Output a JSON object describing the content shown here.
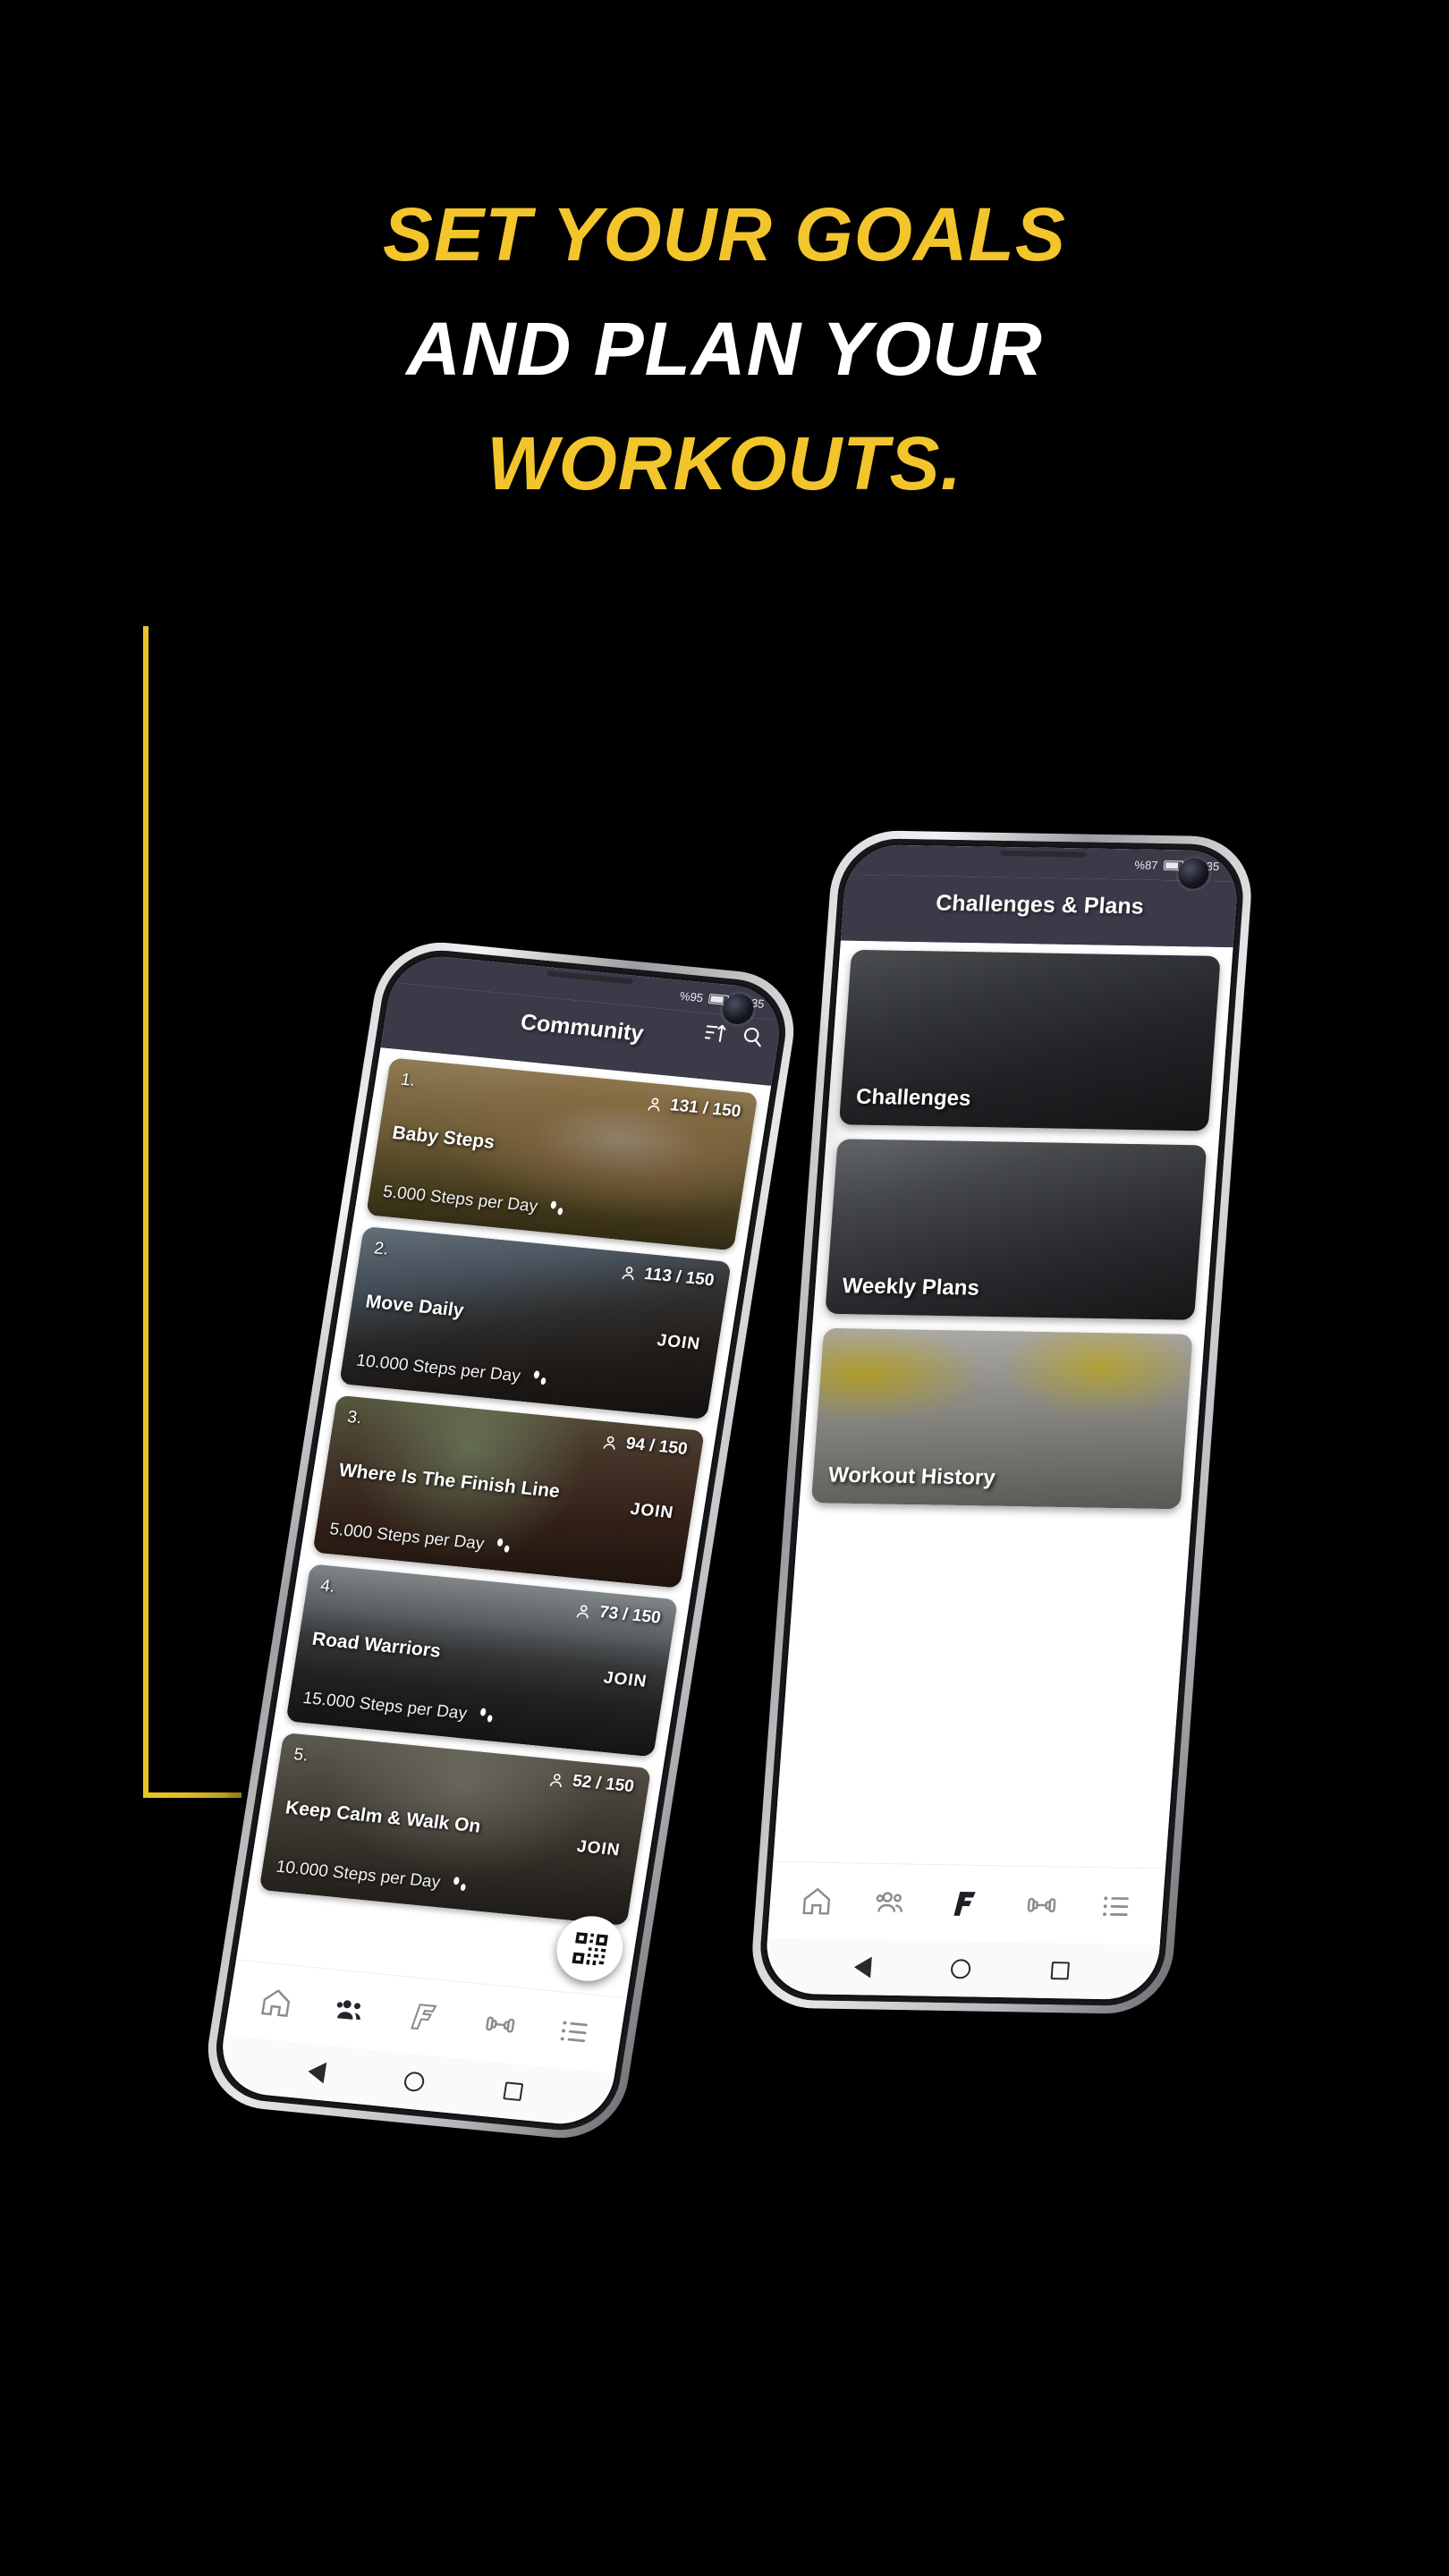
{
  "headline": {
    "line1": "SET YOUR GOALS",
    "line2": "AND PLAN YOUR",
    "line3": "WORKOUTS.",
    "accent_color": "#F2C52D",
    "text_color": "#FFFFFF",
    "background_color": "#000000"
  },
  "decoration": {
    "bracket_color": "#E8C526"
  },
  "phone_front": {
    "status": {
      "battery": "%95",
      "time": "15:35"
    },
    "appbar": {
      "title": "Community",
      "sort_icon": "sort-icon",
      "search_icon": "search-icon"
    },
    "challenges": [
      {
        "rank": "1.",
        "name": "Baby Steps",
        "steps": "5.000 Steps per Day",
        "count": "131 / 150",
        "join": ""
      },
      {
        "rank": "2.",
        "name": "Move Daily",
        "steps": "10.000 Steps per Day",
        "count": "113 / 150",
        "join": "JOIN"
      },
      {
        "rank": "3.",
        "name": "Where Is The Finish Line",
        "steps": "5.000 Steps per Day",
        "count": "94 / 150",
        "join": "JOIN"
      },
      {
        "rank": "4.",
        "name": "Road Warriors",
        "steps": "15.000 Steps per Day",
        "count": "73 / 150",
        "join": "JOIN"
      },
      {
        "rank": "5.",
        "name": "Keep Calm & Walk On",
        "steps": "10.000 Steps per Day",
        "count": "52 / 150",
        "join": "JOIN"
      }
    ],
    "fab": {
      "icon": "qr-code-icon"
    },
    "nav": [
      {
        "icon": "home-icon",
        "active": false
      },
      {
        "icon": "people-icon",
        "active": true
      },
      {
        "icon": "f-logo-icon",
        "active": false
      },
      {
        "icon": "dumbbell-icon",
        "active": false
      },
      {
        "icon": "list-icon",
        "active": false
      }
    ]
  },
  "phone_back": {
    "status": {
      "battery": "%87",
      "time": "15:35"
    },
    "appbar": {
      "title": "Challenges & Plans"
    },
    "cards": [
      {
        "label": "Challenges"
      },
      {
        "label": "Weekly Plans"
      },
      {
        "label": "Workout History"
      }
    ],
    "nav": [
      {
        "icon": "home-icon",
        "active": false
      },
      {
        "icon": "people-icon",
        "active": false
      },
      {
        "icon": "f-logo-icon",
        "active": true
      },
      {
        "icon": "dumbbell-icon",
        "active": false
      },
      {
        "icon": "list-icon",
        "active": false
      }
    ]
  }
}
